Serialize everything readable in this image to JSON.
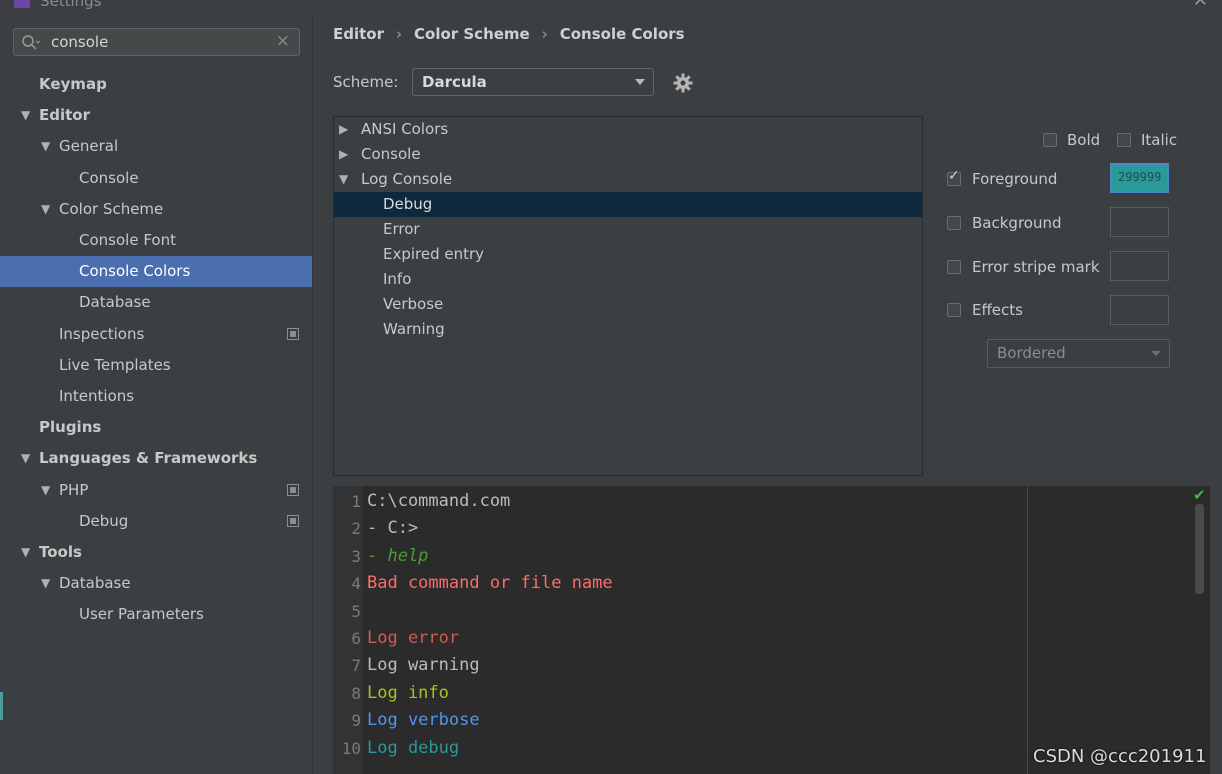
{
  "window": {
    "title": "Settings"
  },
  "search": {
    "value": "console",
    "clear_glyph": "×"
  },
  "sidebar": {
    "items": [
      {
        "label": "Keymap",
        "bold": true,
        "level": 0,
        "toggle": ""
      },
      {
        "label": "Editor",
        "bold": true,
        "level": 0,
        "toggle": "▼"
      },
      {
        "label": "General",
        "bold": false,
        "level": 1,
        "toggle": "▼"
      },
      {
        "label": "Console",
        "bold": false,
        "level": 2,
        "toggle": ""
      },
      {
        "label": "Color Scheme",
        "bold": false,
        "level": 1,
        "toggle": "▼"
      },
      {
        "label": "Console Font",
        "bold": false,
        "level": 2,
        "toggle": ""
      },
      {
        "label": "Console Colors",
        "bold": false,
        "level": 2,
        "toggle": "",
        "selected": true
      },
      {
        "label": "Database",
        "bold": false,
        "level": 2,
        "toggle": ""
      },
      {
        "label": "Inspections",
        "bold": false,
        "level": 1,
        "toggle": "",
        "copy": true
      },
      {
        "label": "Live Templates",
        "bold": false,
        "level": 1,
        "toggle": ""
      },
      {
        "label": "Intentions",
        "bold": false,
        "level": 1,
        "toggle": ""
      },
      {
        "label": "Plugins",
        "bold": true,
        "level": 0,
        "toggle": ""
      },
      {
        "label": "Languages & Frameworks",
        "bold": true,
        "level": 0,
        "toggle": "▼"
      },
      {
        "label": "PHP",
        "bold": false,
        "level": 1,
        "toggle": "▼",
        "copy": true
      },
      {
        "label": "Debug",
        "bold": false,
        "level": 2,
        "toggle": "",
        "copy": true
      },
      {
        "label": "Tools",
        "bold": true,
        "level": 0,
        "toggle": "▼"
      },
      {
        "label": "Database",
        "bold": false,
        "level": 1,
        "toggle": "▼"
      },
      {
        "label": "User Parameters",
        "bold": false,
        "level": 2,
        "toggle": ""
      }
    ]
  },
  "breadcrumb": {
    "items": [
      "Editor",
      "Color Scheme",
      "Console Colors"
    ],
    "separator": "›"
  },
  "scheme": {
    "label": "Scheme:",
    "value": "Darcula"
  },
  "categories": [
    {
      "label": "ANSI Colors",
      "level": 0,
      "toggle": "▶"
    },
    {
      "label": "Console",
      "level": 0,
      "toggle": "▶"
    },
    {
      "label": "Log Console",
      "level": 0,
      "toggle": "▼"
    },
    {
      "label": "Debug",
      "level": 1,
      "toggle": "",
      "selected": true
    },
    {
      "label": "Error",
      "level": 1,
      "toggle": ""
    },
    {
      "label": "Expired entry",
      "level": 1,
      "toggle": ""
    },
    {
      "label": "Info",
      "level": 1,
      "toggle": ""
    },
    {
      "label": "Verbose",
      "level": 1,
      "toggle": ""
    },
    {
      "label": "Warning",
      "level": 1,
      "toggle": ""
    }
  ],
  "attributes": {
    "bold_label": "Bold",
    "italic_label": "Italic",
    "foreground_label": "Foreground",
    "foreground_value": "299999",
    "foreground_color": "#299999",
    "foreground_checked": true,
    "background_label": "Background",
    "error_stripe_label": "Error stripe mark",
    "effects_label": "Effects",
    "effects_type": "Bordered"
  },
  "preview": {
    "lines": [
      {
        "num": "1",
        "text": "C:\\command.com",
        "color": "#bbbbbb",
        "italic": false
      },
      {
        "num": "2",
        "text": "- C:>",
        "color": "#bbbbbb",
        "italic": false
      },
      {
        "num": "3",
        "text": "- help",
        "color": "#4a9e2f",
        "italic": true
      },
      {
        "num": "4",
        "text": "Bad command or file name",
        "color": "#ff6b68",
        "italic": false
      },
      {
        "num": "5",
        "text": "",
        "color": "#bbbbbb",
        "italic": false
      },
      {
        "num": "6",
        "text": "Log error",
        "color": "#cf5b56",
        "italic": false
      },
      {
        "num": "7",
        "text": "Log warning",
        "color": "#bbbbbb",
        "italic": false
      },
      {
        "num": "8",
        "text": "Log info",
        "color": "#a8c023",
        "italic": false
      },
      {
        "num": "9",
        "text": "Log verbose",
        "color": "#5394ec",
        "italic": false
      },
      {
        "num": "10",
        "text": "Log debug",
        "color": "#299999",
        "italic": false
      }
    ]
  },
  "watermark": "CSDN @ccc201911"
}
